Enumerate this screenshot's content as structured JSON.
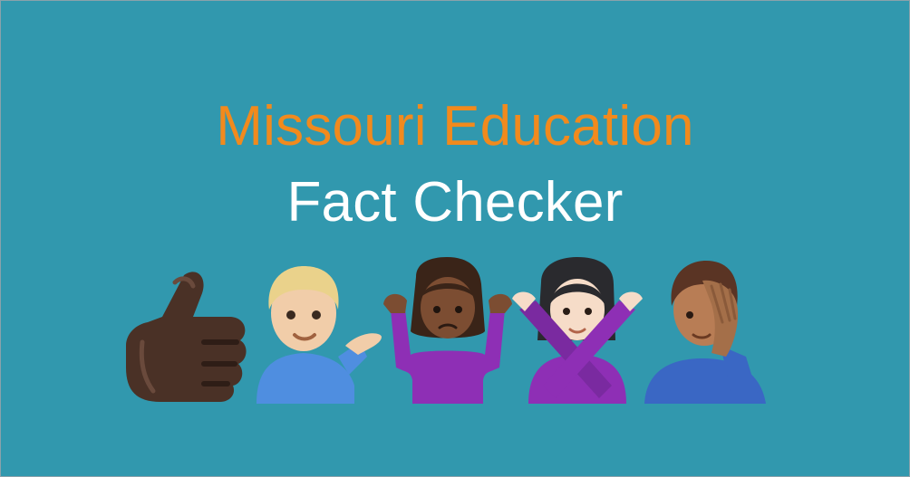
{
  "banner": {
    "line1": "Missouri Education",
    "line2": "Fact Checker",
    "colors": {
      "background": "#3198ae",
      "line1": "#f18a1d",
      "line2": "#ffffff"
    }
  },
  "emojis": [
    {
      "name": "thumbs-up-dark-skin-tone",
      "icon": "thumbs-up-icon"
    },
    {
      "name": "man-tipping-hand-light-skin-tone",
      "icon": "person-tipping-hand-icon"
    },
    {
      "name": "woman-shrugging-dark-skin-tone",
      "icon": "person-shrugging-icon"
    },
    {
      "name": "woman-gesturing-no-light-skin-tone",
      "icon": "person-gesturing-no-icon"
    },
    {
      "name": "man-facepalming-medium-skin-tone",
      "icon": "person-facepalming-icon"
    }
  ]
}
